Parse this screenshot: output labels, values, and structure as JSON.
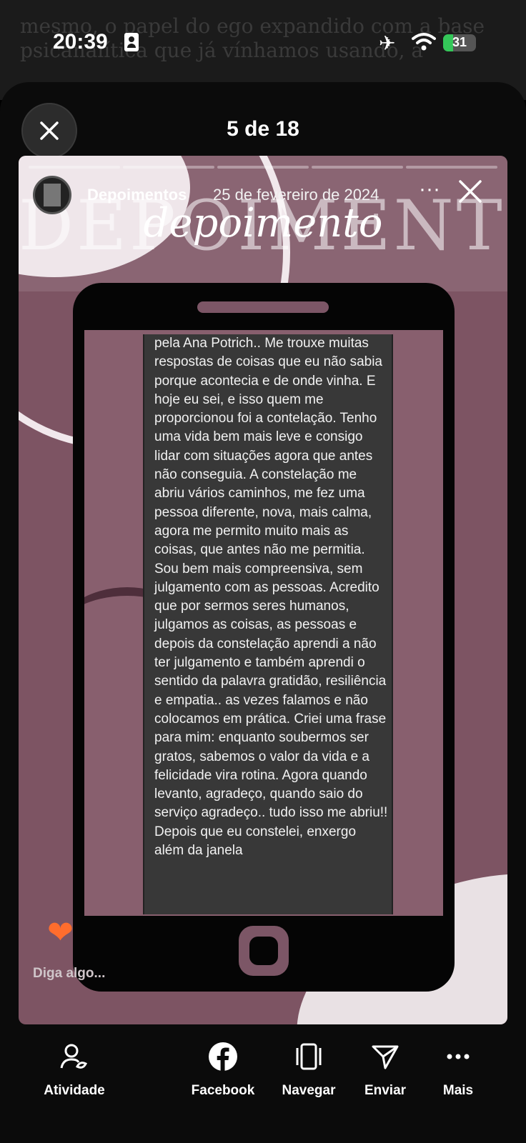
{
  "background_page": {
    "text": "mesmo, o papel do ego expandido com a base psicanalítica que já vínhamos usando, a"
  },
  "status_bar": {
    "time": "20:39",
    "battery": "31",
    "battery_level": 0.31
  },
  "header": {
    "title": "5 de 18"
  },
  "story": {
    "username": "Depoimentos",
    "date": "25 de fevereiro de 2024",
    "more_label": "···",
    "big_title": "DEPOIMENTO",
    "script_title": "depoimento",
    "progress_segments": 5,
    "testimonial": "pela Ana Potrich.. Me trouxe muitas respostas de coisas que eu não sabia porque acontecia e de onde vinha. E hoje eu sei, e isso quem me proporcionou foi a contelação. Tenho uma vida bem mais leve e consigo lidar com situações agora que antes não conseguia. A constelação me abriu vários caminhos, me fez uma pessoa diferente, nova, mais calma, agora me permito muito mais as coisas, que antes não me permitia. Sou bem mais compreensiva, sem julgamento com as pessoas. Acredito que por sermos seres humanos, julgamos as coisas, as pessoas e depois da constelação aprendi a não ter julgamento e também aprendi o sentido da palavra gratidão, resiliência e empatia.. as vezes falamos e não colocamos em prática. Criei uma frase para mim: enquanto soubermos ser gratos, sabemos o valor da vida e a felicidade vira rotina. Agora quando levanto, agradeço, quando saio do serviço agradeço.. tudo isso me abriu!! Depois que eu constelei, enxergo além da janela",
    "reply_placeholder": "Diga algo..."
  },
  "actions": [
    {
      "label": "Atividade",
      "icon": "activity-icon"
    },
    {
      "label": "Facebook",
      "icon": "facebook-icon"
    },
    {
      "label": "Navegar",
      "icon": "navigate-icon"
    },
    {
      "label": "Enviar",
      "icon": "send-icon"
    },
    {
      "label": "Mais",
      "icon": "more-icon"
    }
  ],
  "colors": {
    "story_bg": "#7d5463",
    "accent_battery": "#34c759",
    "heart": "#ff6d2d"
  }
}
